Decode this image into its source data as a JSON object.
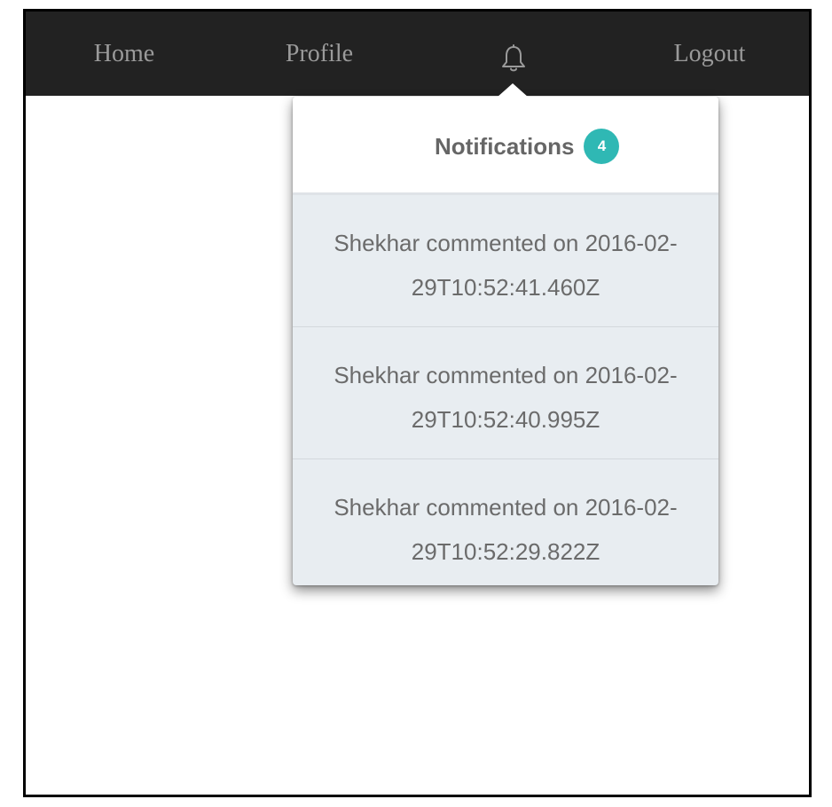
{
  "navbar": {
    "home_label": "Home",
    "profile_label": "Profile",
    "bell_icon": "bell-icon",
    "logout_label": "Logout"
  },
  "notifications": {
    "title": "Notifications",
    "count": "4",
    "items": [
      {
        "line1": "Shekhar commented on 2016-02-",
        "line2": "29T10:52:41.460Z"
      },
      {
        "line1": "Shekhar commented on 2016-02-",
        "line2": "29T10:52:40.995Z"
      },
      {
        "line1": "Shekhar commented on 2016-02-",
        "line2": "29T10:52:29.822Z"
      }
    ]
  },
  "colors": {
    "navbar_bg": "#222222",
    "nav_text": "#9a9a9a",
    "badge": "#2fb8b4",
    "item_bg": "#e8edf1"
  }
}
